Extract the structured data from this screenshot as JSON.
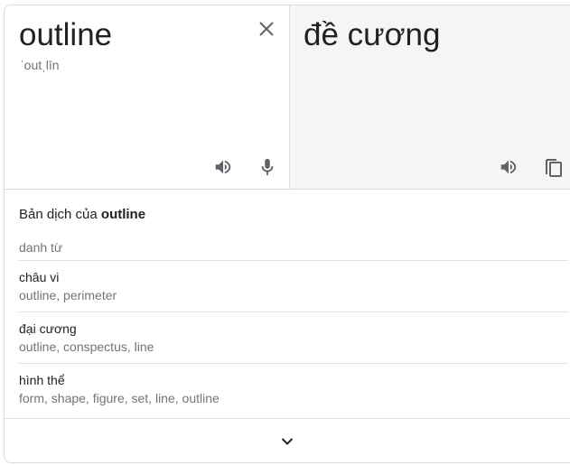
{
  "source": {
    "text": "outline",
    "phonetic": "ˈoutˌlīn",
    "clear_icon": "close-icon",
    "listen_icon": "speaker-icon",
    "mic_icon": "microphone-icon"
  },
  "target": {
    "text": "đề cương",
    "listen_icon": "speaker-icon",
    "copy_icon": "copy-icon"
  },
  "details": {
    "heading_prefix": "Bản dịch của",
    "heading_word": "outline",
    "part_of_speech": "danh từ",
    "entries": [
      {
        "word": "châu vi",
        "synonyms": "outline, perimeter"
      },
      {
        "word": "đại cương",
        "synonyms": "outline, conspectus, line"
      },
      {
        "word": "hình thể",
        "synonyms": "form, shape, figure, set, line, outline"
      }
    ],
    "expand_icon": "chevron-down-icon"
  }
}
